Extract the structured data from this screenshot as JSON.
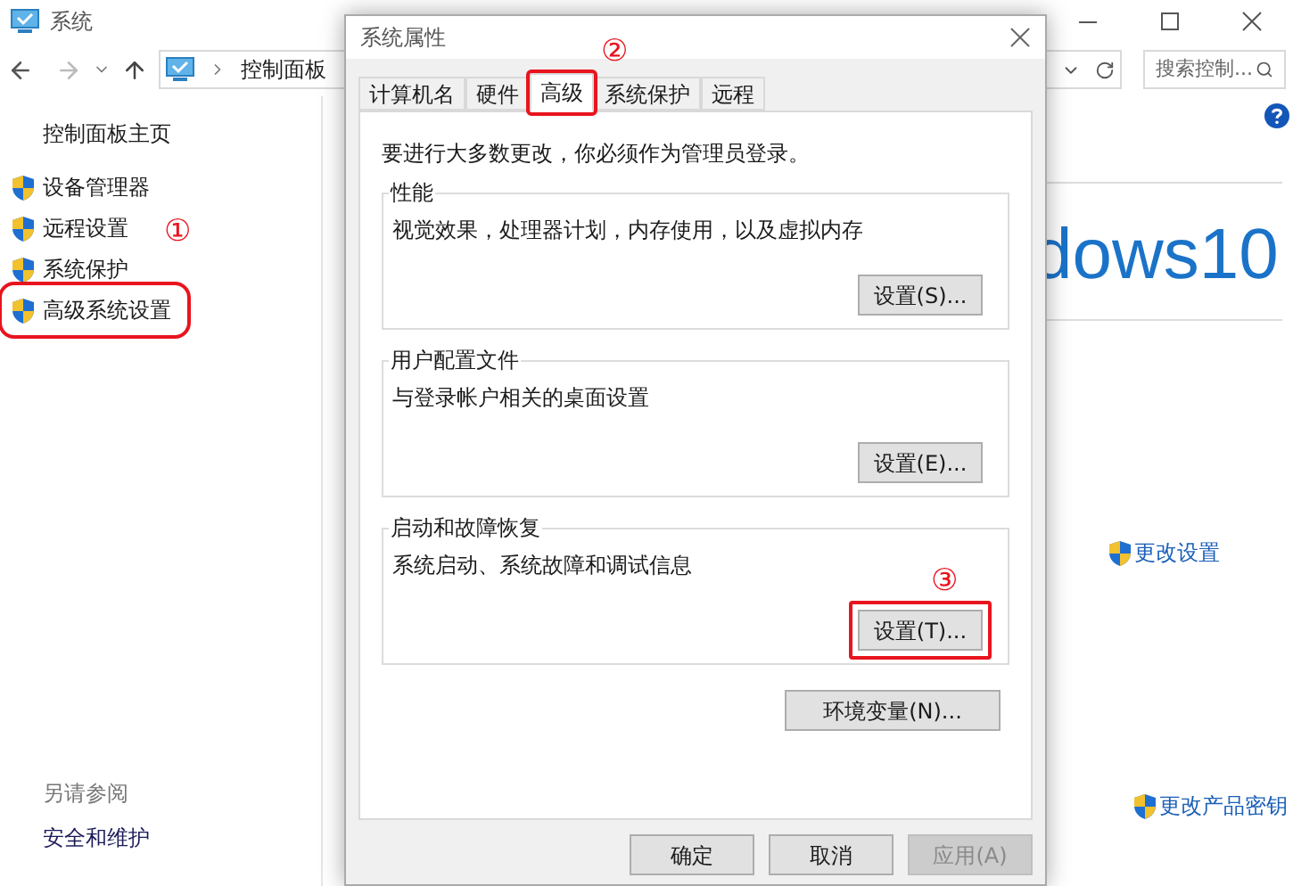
{
  "window": {
    "title": "系统"
  },
  "address_bar": {
    "breadcrumb": [
      "控制面板"
    ],
    "search": {
      "placeholder": "搜索控制..."
    }
  },
  "sidebar": {
    "home": "控制面板主页",
    "items": [
      {
        "label": "设备管理器",
        "highlighted": false
      },
      {
        "label": "远程设置",
        "highlighted": false
      },
      {
        "label": "系统保护",
        "highlighted": false
      },
      {
        "label": "高级系统设置",
        "highlighted": true
      }
    ],
    "see_also": {
      "heading": "另请参阅",
      "links": [
        "安全和维护"
      ]
    }
  },
  "main": {
    "logo_text": "dows10",
    "links": [
      "更改设置",
      "更改产品密钥"
    ]
  },
  "dialog": {
    "title": "系统属性",
    "tabs": [
      {
        "label": "计算机名",
        "selected": false,
        "highlighted": false
      },
      {
        "label": "硬件",
        "selected": false,
        "highlighted": false
      },
      {
        "label": "高级",
        "selected": true,
        "highlighted": true
      },
      {
        "label": "系统保护",
        "selected": false,
        "highlighted": false
      },
      {
        "label": "远程",
        "selected": false,
        "highlighted": false
      }
    ],
    "notice": "要进行大多数更改，你必须作为管理员登录。",
    "groups": [
      {
        "title": "性能",
        "description": "视觉效果，处理器计划，内存使用，以及虚拟内存",
        "button": {
          "label": "设置(S)...",
          "highlighted": false
        }
      },
      {
        "title": "用户配置文件",
        "description": "与登录帐户相关的桌面设置",
        "button": {
          "label": "设置(E)...",
          "highlighted": false
        }
      },
      {
        "title": "启动和故障恢复",
        "description": "系统启动、系统故障和调试信息",
        "button": {
          "label": "设置(T)...",
          "highlighted": true
        }
      }
    ],
    "env_button": "环境变量(N)...",
    "buttons": [
      {
        "label": "确定",
        "disabled": false
      },
      {
        "label": "取消",
        "disabled": false
      },
      {
        "label": "应用(A)",
        "disabled": true
      }
    ]
  },
  "callouts": [
    "①",
    "②",
    "③"
  ]
}
